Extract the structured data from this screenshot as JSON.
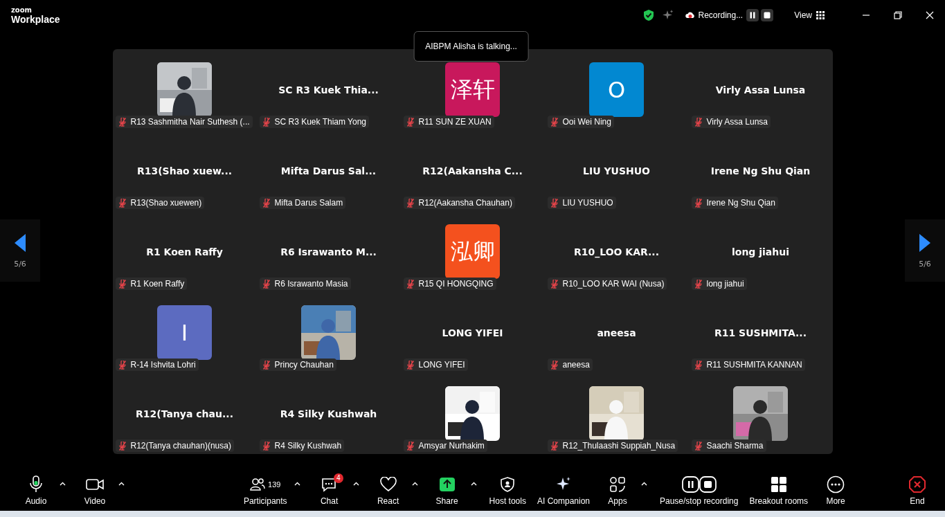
{
  "top_bar": {
    "brand_small": "zoom",
    "brand": "Workplace",
    "recording": "Recording...",
    "view": "View"
  },
  "toast": "AIBPM Alisha is talking...",
  "pager": {
    "left": "5/6",
    "right": "5/6"
  },
  "tiles": [
    {
      "kind": "picture",
      "tag": "R13 Sashmitha Nair Suthesh (...",
      "muted": true
    },
    {
      "kind": "name",
      "display": "SC R3  Kuek Thia...",
      "tag": "SC R3 Kuek Thiam Yong",
      "muted": true
    },
    {
      "kind": "initial",
      "initial": "泽轩",
      "color": "#c8185c",
      "tag": "R11 SUN ZE XUAN",
      "muted": true
    },
    {
      "kind": "initial",
      "initial": "O",
      "color": "#0288d1",
      "tag": "Ooi Wei Ning",
      "muted": true
    },
    {
      "kind": "name",
      "display": "Virly Assa Lunsa",
      "tag": "Virly Assa Lunsa",
      "muted": true
    },
    {
      "kind": "name",
      "display": "R13(Shao  xuew...",
      "tag": "R13(Shao xuewen)",
      "muted": true
    },
    {
      "kind": "name",
      "display": "Mifta  Darus  Sal...",
      "tag": "Mifta Darus Salam",
      "muted": true
    },
    {
      "kind": "name",
      "display": "R12(Aakansha  C...",
      "tag": "R12(Aakansha Chauhan)",
      "muted": true
    },
    {
      "kind": "name",
      "display": "LIU YUSHUO",
      "tag": "LIU YUSHUO",
      "muted": true
    },
    {
      "kind": "name",
      "display": "Irene Ng Shu Qian",
      "tag": "Irene Ng Shu Qian",
      "muted": true
    },
    {
      "kind": "name",
      "display": "R1 Koen Raffy",
      "tag": "R1 Koen Raffy",
      "muted": true
    },
    {
      "kind": "name",
      "display": "R6  Israwanto  M...",
      "tag": "R6 Israwanto Masia",
      "muted": true
    },
    {
      "kind": "initial",
      "initial": "泓卿",
      "color": "#f4511e",
      "tag": "R15 QI HONGQING",
      "muted": true
    },
    {
      "kind": "name",
      "display": "R10_LOO KAR...",
      "tag": "R10_LOO KAR WAI (Nusa)",
      "muted": true
    },
    {
      "kind": "name",
      "display": "long jiahui",
      "tag": "long jiahui",
      "muted": true
    },
    {
      "kind": "initial",
      "initial": "I",
      "color": "#5c6bc0",
      "tag": "R-14 Ishvita Lohri",
      "muted": true
    },
    {
      "kind": "picture",
      "tag": "Princy Chauhan",
      "muted": true
    },
    {
      "kind": "name",
      "display": "LONG YIFEI",
      "tag": "LONG YIFEI",
      "muted": true
    },
    {
      "kind": "name",
      "display": "aneesa",
      "tag": "aneesa",
      "muted": true
    },
    {
      "kind": "name",
      "display": "R11  SUSHMITA...",
      "tag": "R11 SUSHMITA KANNAN",
      "muted": true
    },
    {
      "kind": "name",
      "display": "R12(Tanya  chau...",
      "tag": "R12(Tanya chauhan)(nusa)",
      "muted": true
    },
    {
      "kind": "name",
      "display": "R4 Silky Kushwah",
      "tag": "R4 Silky Kushwah",
      "muted": true
    },
    {
      "kind": "picture",
      "tag": "Amsyar Nurhakim",
      "muted": true
    },
    {
      "kind": "picture",
      "tag": "R12_Thulaashi Suppiah_Nusa",
      "muted": true
    },
    {
      "kind": "picture",
      "tag": "Saachi Sharma",
      "muted": true
    }
  ],
  "toolbar": [
    {
      "kind": "audio",
      "label": "Audio",
      "caret": true
    },
    {
      "kind": "video",
      "label": "Video",
      "caret": true
    },
    {
      "kind": "participants",
      "label": "Participants",
      "count": "139",
      "caret": true
    },
    {
      "kind": "chat",
      "label": "Chat",
      "badge": "4",
      "caret": true
    },
    {
      "kind": "react",
      "label": "React",
      "caret": true
    },
    {
      "kind": "share",
      "label": "Share",
      "caret": true
    },
    {
      "kind": "host",
      "label": "Host tools",
      "caret": false
    },
    {
      "kind": "ai",
      "label": "AI Companion",
      "caret": false
    },
    {
      "kind": "apps",
      "label": "Apps",
      "caret": true
    },
    {
      "kind": "record",
      "label": "Pause/stop recording",
      "caret": false
    },
    {
      "kind": "breakout",
      "label": "Breakout rooms",
      "caret": false
    },
    {
      "kind": "more",
      "label": "More",
      "caret": false
    },
    {
      "kind": "end",
      "label": "End",
      "caret": false
    }
  ]
}
